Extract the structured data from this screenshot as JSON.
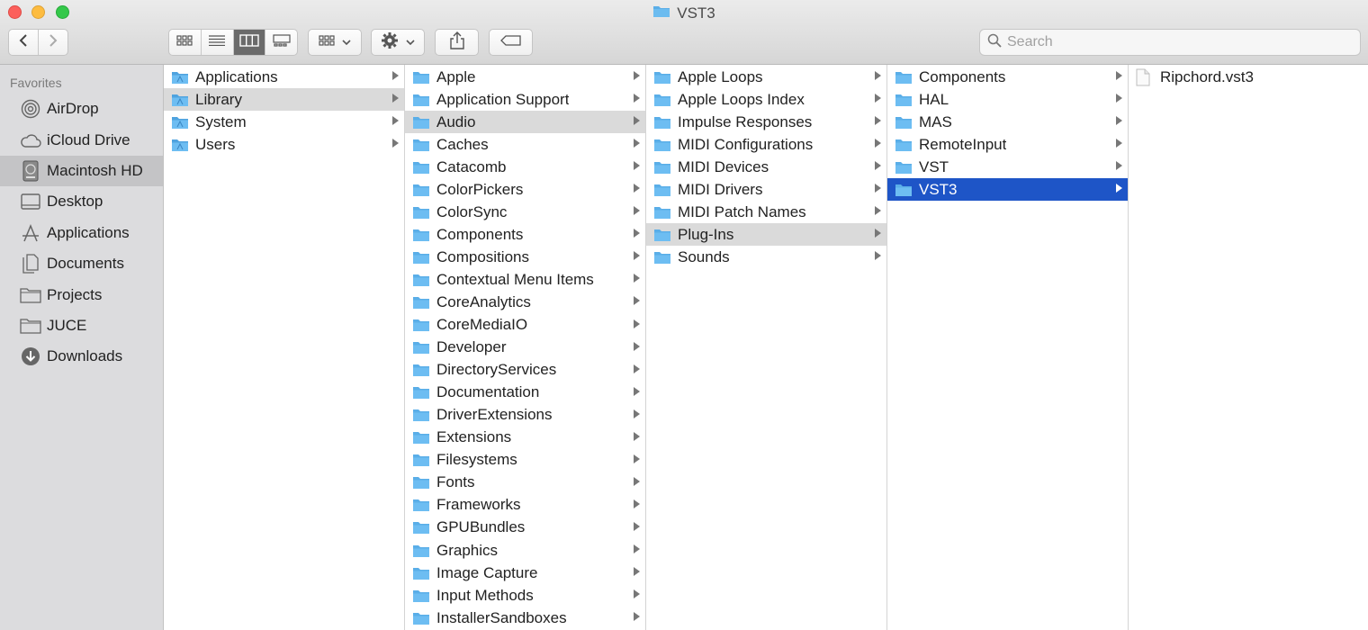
{
  "window": {
    "title": "VST3"
  },
  "toolbar": {
    "search_placeholder": "Search"
  },
  "sidebar": {
    "header": "Favorites",
    "items": [
      {
        "label": "AirDrop",
        "icon": "airdrop-icon"
      },
      {
        "label": "iCloud Drive",
        "icon": "cloud-icon"
      },
      {
        "label": "Macintosh HD",
        "icon": "harddisk-icon",
        "selected": true
      },
      {
        "label": "Desktop",
        "icon": "desktop-icon"
      },
      {
        "label": "Applications",
        "icon": "applications-icon"
      },
      {
        "label": "Documents",
        "icon": "documents-icon"
      },
      {
        "label": "Projects",
        "icon": "folder-icon"
      },
      {
        "label": "JUCE",
        "icon": "folder-icon"
      },
      {
        "label": "Downloads",
        "icon": "downloads-icon"
      }
    ]
  },
  "columns": [
    {
      "items": [
        "Applications",
        "Library",
        "System",
        "Users"
      ],
      "selected": "Library"
    },
    {
      "items": [
        "Apple",
        "Application Support",
        "Audio",
        "Caches",
        "Catacomb",
        "ColorPickers",
        "ColorSync",
        "Components",
        "Compositions",
        "Contextual Menu Items",
        "CoreAnalytics",
        "CoreMediaIO",
        "Developer",
        "DirectoryServices",
        "Documentation",
        "DriverExtensions",
        "Extensions",
        "Filesystems",
        "Fonts",
        "Frameworks",
        "GPUBundles",
        "Graphics",
        "Image Capture",
        "Input Methods",
        "InstallerSandboxes"
      ],
      "selected": "Audio"
    },
    {
      "items": [
        "Apple Loops",
        "Apple Loops Index",
        "Impulse Responses",
        "MIDI Configurations",
        "MIDI Devices",
        "MIDI Drivers",
        "MIDI Patch Names",
        "Plug-Ins",
        "Sounds"
      ],
      "selected": "Plug-Ins"
    },
    {
      "items": [
        "Components",
        "HAL",
        "MAS",
        "RemoteInput",
        "VST",
        "VST3"
      ],
      "selected": "VST3",
      "active": true
    },
    {
      "items": [
        "Ripchord.vst3"
      ],
      "files": true
    }
  ],
  "colors": {
    "selection_active": "#1e55c7",
    "selection_path": "#dadada",
    "folder": "#5aaee8"
  }
}
